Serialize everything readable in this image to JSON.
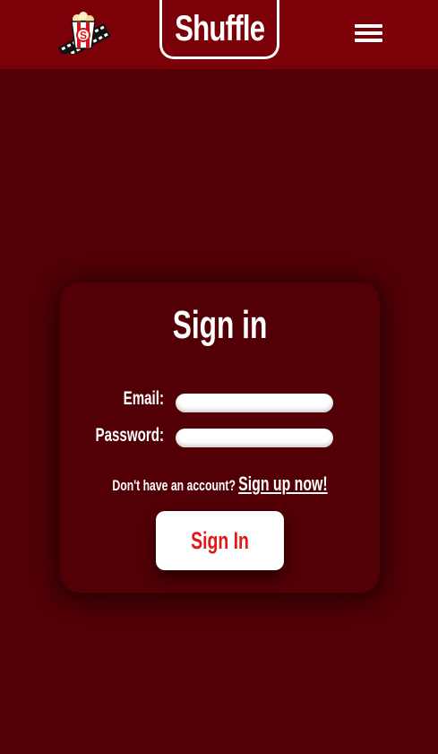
{
  "header": {
    "brand_title": "Shuffle",
    "logo_letter": "S"
  },
  "signin_card": {
    "title": "Sign in",
    "email_label": "Email:",
    "email_value": "",
    "password_label": "Password:",
    "password_value": "",
    "signup_prompt": "Don't have an account?",
    "signup_link": "Sign up now!",
    "signin_button": "Sign In"
  },
  "colors": {
    "navbar_bg": "#7c0008",
    "page_bg": "#520006",
    "card_bg": "#520006",
    "accent_red": "#e01818",
    "text_white": "#ffffff"
  },
  "icons": {
    "logo": "popcorn-film-logo-icon",
    "menu": "hamburger-menu-icon"
  }
}
